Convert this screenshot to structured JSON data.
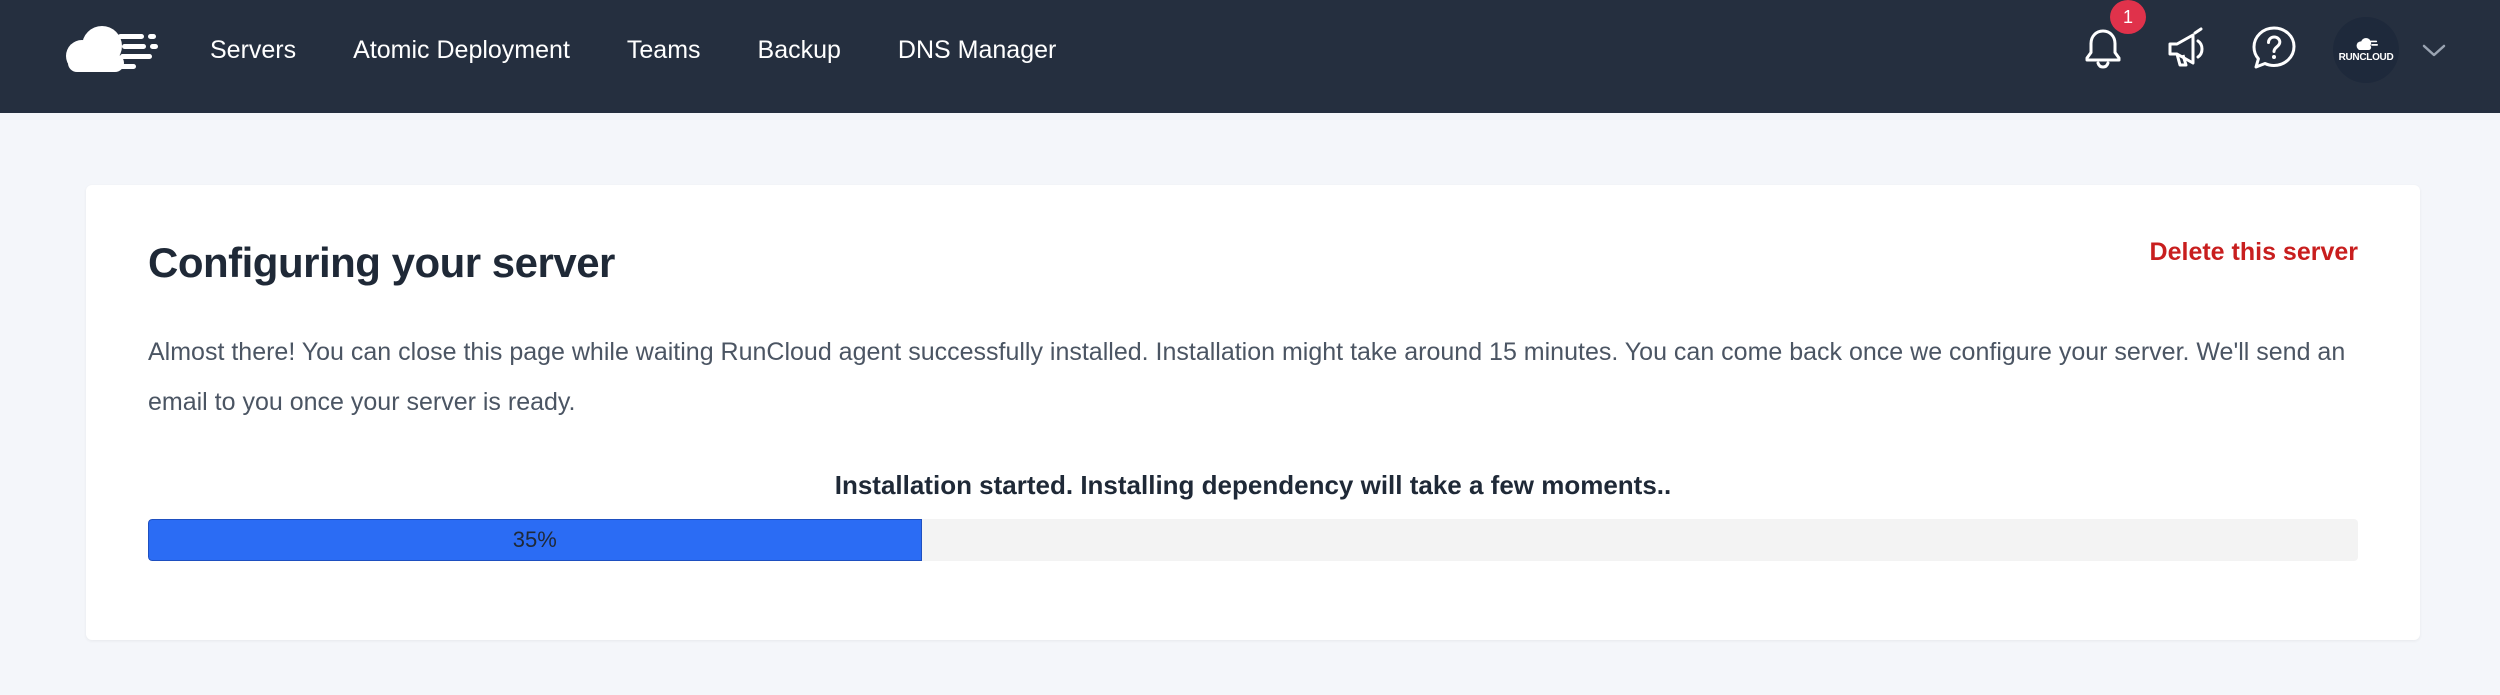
{
  "header": {
    "logo": "runcloud-cloud-icon",
    "nav": [
      {
        "label": "Servers"
      },
      {
        "label": "Atomic Deployment"
      },
      {
        "label": "Teams"
      },
      {
        "label": "Backup"
      },
      {
        "label": "DNS Manager"
      }
    ],
    "notifications": {
      "icon": "bell-icon",
      "count": "1"
    },
    "announcements": {
      "icon": "megaphone-icon"
    },
    "help": {
      "icon": "question-icon"
    },
    "avatar": {
      "text": "RUNCLOUD"
    },
    "menu_toggle": {
      "icon": "chevron-down-icon"
    }
  },
  "card": {
    "title": "Configuring your server",
    "delete_label": "Delete this server",
    "description": "Almost there! You can close this page while waiting RunCloud agent successfully installed. Installation might take around 15 minutes. You can come back once we configure your server. We'll send an email to you once your server is ready.",
    "status": "Installation started. Installing dependency will take a few moments..",
    "progress": {
      "value": 35,
      "label": "35%"
    }
  },
  "colors": {
    "header_bg": "#252f3f",
    "page_bg": "#f4f6fa",
    "progress_fill": "#2b6cf4",
    "danger": "#c81e1e",
    "badge": "#e0324b"
  }
}
